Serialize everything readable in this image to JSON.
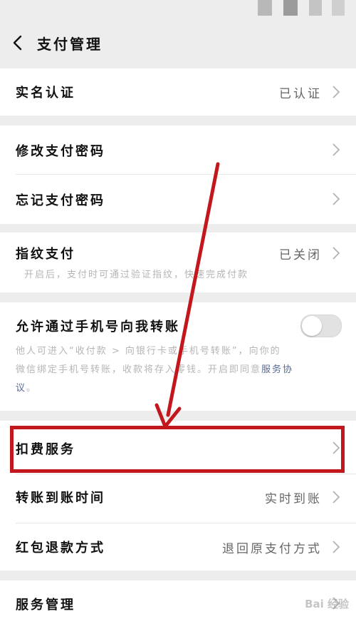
{
  "header": {
    "title": "支付管理"
  },
  "sections": {
    "realname": {
      "label": "实名认证",
      "value": "已认证"
    },
    "change_pwd": {
      "label": "修改支付密码"
    },
    "forgot_pwd": {
      "label": "忘记支付密码"
    },
    "fingerprint": {
      "label": "指纹支付",
      "value": "已关闭",
      "desc": "开启后，支付时可通过验证指纹，快速完成付款"
    },
    "phone_transfer": {
      "label": "允许通过手机号向我转账",
      "desc_line1": "他人可进入“收付款 > 向银行卡或手机号转账”，向你的",
      "desc_line2_prefix": "微信绑定手机号转账，收款将存入零钱。开启即同意",
      "link_part1": "服务协",
      "link_part2": "议",
      "desc_end": "。",
      "enabled": false
    },
    "deduction": {
      "label": "扣费服务"
    },
    "arrival_time": {
      "label": "转账到账时间",
      "value": "实时到账"
    },
    "redpacket_refund": {
      "label": "红包退款方式",
      "value": "退回原支付方式"
    },
    "service_mgmt": {
      "label": "服务管理"
    }
  },
  "annotation": {
    "color": "#c2181d"
  },
  "watermark": {
    "text": "Bai 经验"
  }
}
